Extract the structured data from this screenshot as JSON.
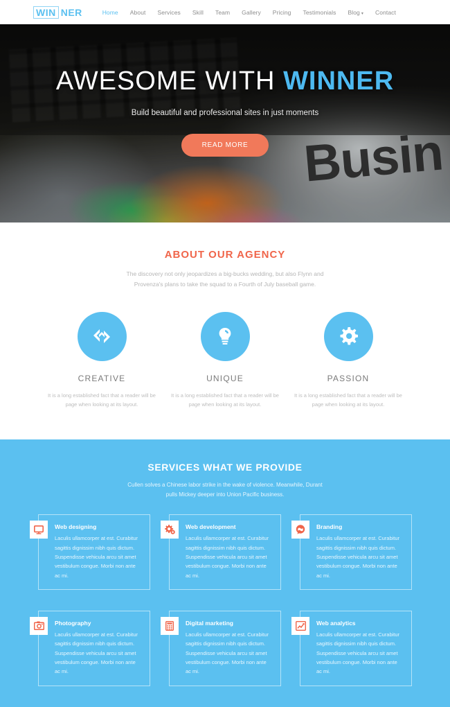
{
  "colors": {
    "brand_blue": "#5bc0f0",
    "accent_orange": "#f0654a",
    "button_orange": "#f1795a",
    "hero_accent": "#4db9f0"
  },
  "header": {
    "logo_box": "WIN",
    "logo_rest": "NER",
    "nav": [
      {
        "label": "Home",
        "active": true
      },
      {
        "label": "About",
        "active": false
      },
      {
        "label": "Services",
        "active": false
      },
      {
        "label": "Skill",
        "active": false
      },
      {
        "label": "Team",
        "active": false
      },
      {
        "label": "Gallery",
        "active": false
      },
      {
        "label": "Pricing",
        "active": false
      },
      {
        "label": "Testimonials",
        "active": false
      },
      {
        "label": "Blog",
        "active": false,
        "caret": "▾"
      },
      {
        "label": "Contact",
        "active": false
      }
    ]
  },
  "hero": {
    "title_plain": "AWESOME WITH ",
    "title_accent": "WINNER",
    "subtitle": "Build beautiful and professional sites in just moments",
    "button_label": "READ MORE",
    "background_word": "Busin"
  },
  "about": {
    "title": "ABOUT OUR AGENCY",
    "subtitle": "The discovery not only jeopardizes a big-bucks wedding, but also Flynn and Provenza's plans to take the squad to a Fourth of July baseball game.",
    "features": [
      {
        "icon": "interlocking-diamonds-icon",
        "title": "CREATIVE",
        "text": "It is a long established fact that a reader will be page when looking at its layout."
      },
      {
        "icon": "lightbulb-icon",
        "title": "UNIQUE",
        "text": "It is a long established fact that a reader will be page when looking at its layout."
      },
      {
        "icon": "gear-icon",
        "title": "PASSION",
        "text": "It is a long established fact that a reader will be page when looking at its layout."
      }
    ]
  },
  "services": {
    "title": "SERVICES WHAT WE PROVIDE",
    "subtitle": "Cullen solves a Chinese labor strike in the wake of violence. Meanwhile, Durant pulls Mickey deeper into Union Pacific business.",
    "cards": [
      {
        "icon": "monitor-icon",
        "name": "Web designing",
        "text": "Laculis ullamcorper at est. Curabitur sagittis dignissim nibh quis dictum. Suspendisse vehicula arcu sit amet vestibulum congue. Morbi non ante ac mi."
      },
      {
        "icon": "gears-icon",
        "name": "Web development",
        "text": "Laculis ullamcorper at est. Curabitur sagittis dignissim nibh quis dictum. Suspendisse vehicula arcu sit amet vestibulum congue. Morbi non ante ac mi."
      },
      {
        "icon": "speech-bubble-icon",
        "name": "Branding",
        "text": "Laculis ullamcorper at est. Curabitur sagittis dignissim nibh quis dictum. Suspendisse vehicula arcu sit amet vestibulum congue. Morbi non ante ac mi."
      },
      {
        "icon": "camera-icon",
        "name": "Photography",
        "text": "Laculis ullamcorper at est. Curabitur sagittis dignissim nibh quis dictum. Suspendisse vehicula arcu sit amet vestibulum congue. Morbi non ante ac mi."
      },
      {
        "icon": "calculator-icon",
        "name": "Digital marketing",
        "text": "Laculis ullamcorper at est. Curabitur sagittis dignissim nibh quis dictum. Suspendisse vehicula arcu sit amet vestibulum congue. Morbi non ante ac mi."
      },
      {
        "icon": "line-chart-icon",
        "name": "Web analytics",
        "text": "Laculis ullamcorper at est. Curabitur sagittis dignissim nibh quis dictum. Suspendisse vehicula arcu sit amet vestibulum congue. Morbi non ante ac mi."
      }
    ]
  }
}
